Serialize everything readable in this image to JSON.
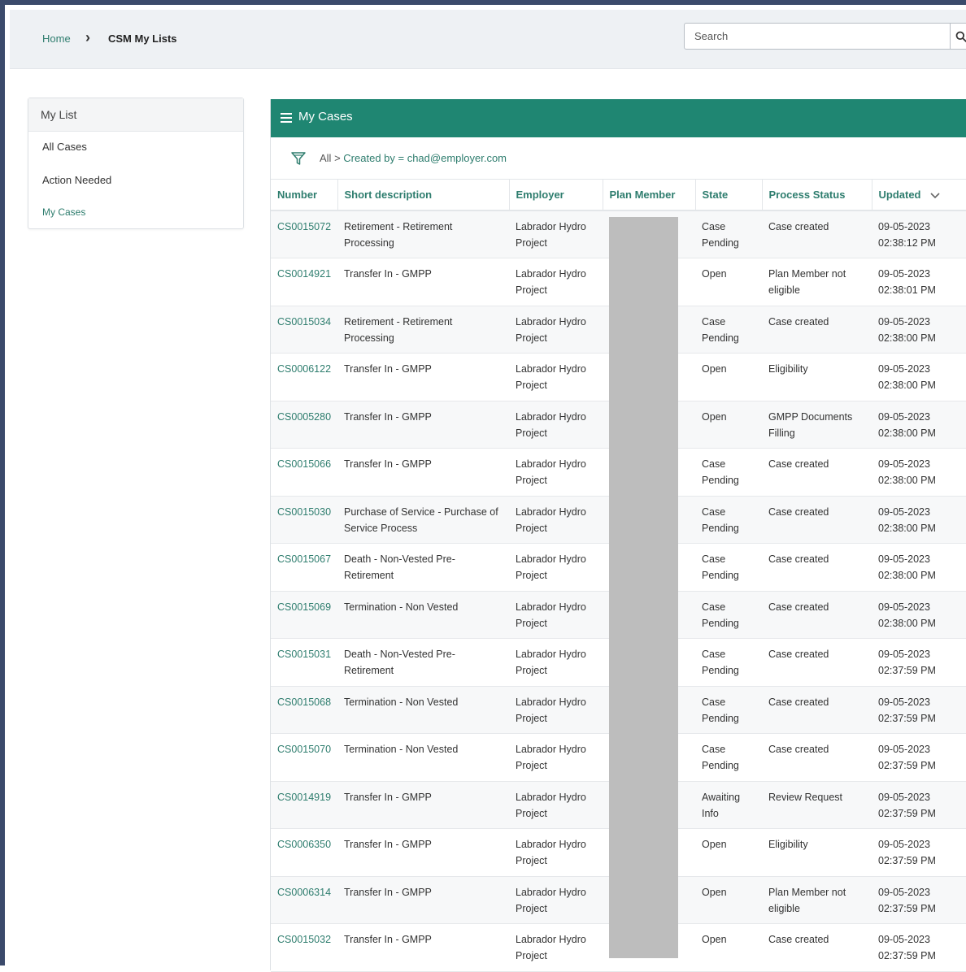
{
  "breadcrumb": {
    "home": "Home",
    "current": "CSM My Lists"
  },
  "search": {
    "placeholder": "Search",
    "icon": "search-icon"
  },
  "sidebar": {
    "title": "My List",
    "items": [
      {
        "label": "All Cases"
      },
      {
        "label": "Action Needed"
      },
      {
        "label": "My Cases",
        "active": true
      }
    ]
  },
  "panel": {
    "title": "My Cases",
    "filter": {
      "all": "All",
      "separator": ">",
      "condition": "Created by = chad@employer.com"
    },
    "accent_color": "#1f8672"
  },
  "table": {
    "columns": [
      "Number",
      "Short description",
      "Employer",
      "Plan Member",
      "State",
      "Process Status",
      "Updated"
    ],
    "sorted_column": "Updated",
    "sort_direction": "descending",
    "rows": [
      {
        "number": "CS0015072",
        "desc": "Retirement - Retirement Processing",
        "employer": "Labrador Hydro Project",
        "member": "",
        "state": "Case Pending",
        "status": "Case created",
        "updated": "09-05-2023 02:38:12 PM"
      },
      {
        "number": "CS0014921",
        "desc": "Transfer In - GMPP",
        "employer": "Labrador Hydro Project",
        "member": "",
        "state": "Open",
        "status": "Plan Member not eligible",
        "updated": "09-05-2023 02:38:01 PM"
      },
      {
        "number": "CS0015034",
        "desc": "Retirement - Retirement Processing",
        "employer": "Labrador Hydro Project",
        "member": "",
        "state": "Case Pending",
        "status": "Case created",
        "updated": "09-05-2023 02:38:00 PM"
      },
      {
        "number": "CS0006122",
        "desc": "Transfer In - GMPP",
        "employer": "Labrador Hydro Project",
        "member": "",
        "state": "Open",
        "status": "Eligibility",
        "updated": "09-05-2023 02:38:00 PM"
      },
      {
        "number": "CS0005280",
        "desc": "Transfer In - GMPP",
        "employer": "Labrador Hydro Project",
        "member": "",
        "state": "Open",
        "status": "GMPP Documents Filling",
        "updated": "09-05-2023 02:38:00 PM"
      },
      {
        "number": "CS0015066",
        "desc": "Transfer In - GMPP",
        "employer": "Labrador Hydro Project",
        "member": "",
        "state": "Case Pending",
        "status": "Case created",
        "updated": "09-05-2023 02:38:00 PM"
      },
      {
        "number": "CS0015030",
        "desc": "Purchase of Service - Purchase of Service Process",
        "employer": "Labrador Hydro Project",
        "member": "",
        "state": "Case Pending",
        "status": "Case created",
        "updated": "09-05-2023 02:38:00 PM"
      },
      {
        "number": "CS0015067",
        "desc": "Death - Non-Vested Pre-Retirement",
        "employer": "Labrador Hydro Project",
        "member": "",
        "state": "Case Pending",
        "status": "Case created",
        "updated": "09-05-2023 02:38:00 PM"
      },
      {
        "number": "CS0015069",
        "desc": "Termination - Non Vested",
        "employer": "Labrador Hydro Project",
        "member": "",
        "state": "Case Pending",
        "status": "Case created",
        "updated": "09-05-2023 02:38:00 PM"
      },
      {
        "number": "CS0015031",
        "desc": "Death - Non-Vested Pre-Retirement",
        "employer": "Labrador Hydro Project",
        "member": "",
        "state": "Case Pending",
        "status": "Case created",
        "updated": "09-05-2023 02:37:59 PM"
      },
      {
        "number": "CS0015068",
        "desc": "Termination - Non Vested",
        "employer": "Labrador Hydro Project",
        "member": "",
        "state": "Case Pending",
        "status": "Case created",
        "updated": "09-05-2023 02:37:59 PM"
      },
      {
        "number": "CS0015070",
        "desc": "Termination - Non Vested",
        "employer": "Labrador Hydro Project",
        "member": "",
        "state": "Case Pending",
        "status": "Case created",
        "updated": "09-05-2023 02:37:59 PM"
      },
      {
        "number": "CS0014919",
        "desc": "Transfer In - GMPP",
        "employer": "Labrador Hydro Project",
        "member": "",
        "state": "Awaiting Info",
        "status": "Review Request",
        "updated": "09-05-2023 02:37:59 PM"
      },
      {
        "number": "CS0006350",
        "desc": "Transfer In - GMPP",
        "employer": "Labrador Hydro Project",
        "member": "",
        "state": "Open",
        "status": "Eligibility",
        "updated": "09-05-2023 02:37:59 PM"
      },
      {
        "number": "CS0006314",
        "desc": "Transfer In - GMPP",
        "employer": "Labrador Hydro Project",
        "member": "",
        "state": "Open",
        "status": "Plan Member not eligible",
        "updated": "09-05-2023 02:37:59 PM"
      },
      {
        "number": "CS0015032",
        "desc": "Transfer In - GMPP",
        "employer": "Labrador Hydro Project",
        "member": "",
        "state": "Open",
        "status": "Case created",
        "updated": "09-05-2023 02:37:59 PM"
      }
    ]
  }
}
